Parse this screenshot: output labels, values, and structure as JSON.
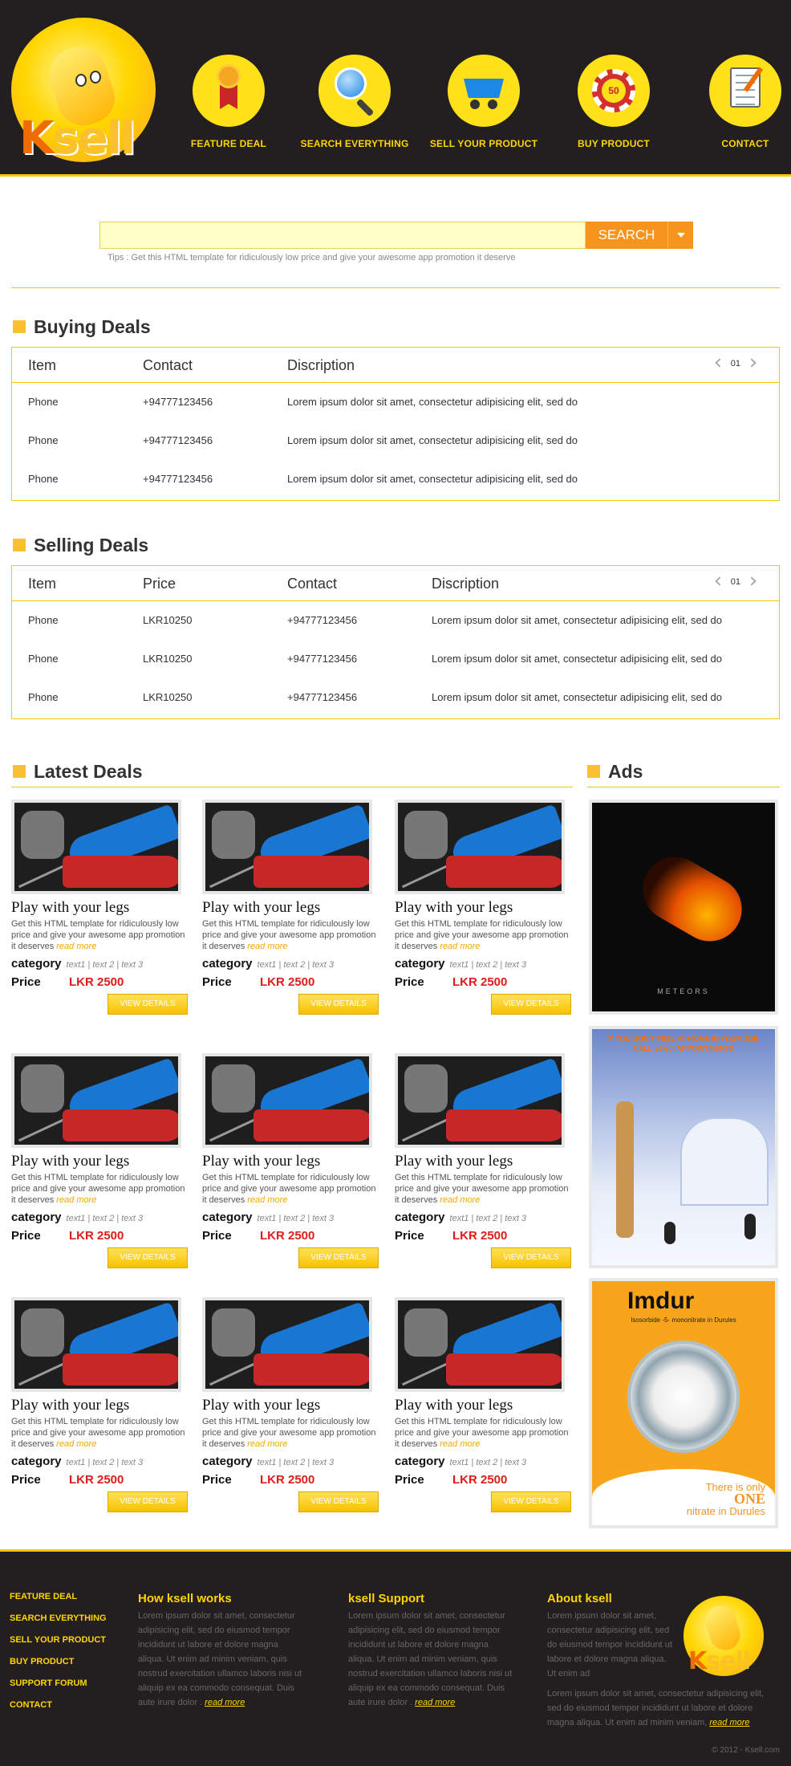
{
  "nav": [
    {
      "label": "FEATURE DEAL",
      "icon": "medal-icon"
    },
    {
      "label": "SEARCH EVERYTHING",
      "icon": "globe-search-icon"
    },
    {
      "label": "SELL YOUR PRODUCT",
      "icon": "cart-icon"
    },
    {
      "label": "BUY PRODUCT",
      "icon": "chip-icon"
    },
    {
      "label": "CONTACT",
      "icon": "notepad-icon"
    }
  ],
  "logo": {
    "k": "K",
    "sell": "sell"
  },
  "search": {
    "button": "SEARCH",
    "tips": "Tips : Get this HTML template for ridiculously low price and give your awesome app promotion it deserve"
  },
  "buying": {
    "title": "Buying Deals",
    "headers": [
      "Item",
      "Contact",
      "Discription"
    ],
    "page": "01",
    "rows": [
      [
        "Phone",
        "+94777123456",
        "Lorem ipsum dolor sit amet, consectetur adipisicing elit, sed do"
      ],
      [
        "Phone",
        "+94777123456",
        "Lorem ipsum dolor sit amet, consectetur adipisicing elit, sed do"
      ],
      [
        "Phone",
        "+94777123456",
        "Lorem ipsum dolor sit amet, consectetur adipisicing elit, sed do"
      ]
    ]
  },
  "selling": {
    "title": "Selling Deals",
    "headers": [
      "Item",
      "Price",
      "Contact",
      "Discription"
    ],
    "page": "01",
    "rows": [
      [
        "Phone",
        "LKR10250",
        "+94777123456",
        "Lorem ipsum dolor sit amet, consectetur adipisicing elit, sed do"
      ],
      [
        "Phone",
        "LKR10250",
        "+94777123456",
        "Lorem ipsum dolor sit amet, consectetur adipisicing elit, sed do"
      ],
      [
        "Phone",
        "LKR10250",
        "+94777123456",
        "Lorem ipsum dolor sit amet, consectetur adipisicing elit, sed do"
      ]
    ]
  },
  "latest": {
    "title": "Latest Deals",
    "card": {
      "title": "Play with your legs",
      "desc": "Get this HTML template for ridiculously low price and give your awesome app promotion it deserves",
      "read_more": "read more",
      "category_label": "category",
      "category_tags": "text1 | text 2 | text 3",
      "price_label": "Price",
      "price": "LKR 2500",
      "button": "VIEW DETAILS"
    }
  },
  "ads": {
    "title": "Ads",
    "ad1": {
      "text": "METEORS"
    },
    "ad2": {
      "text": "IF YOU DON'T FEEL AT HOME IN YOUR JOB, CALL sélect APPOINTMENTS"
    },
    "ad3": {
      "brand": "Imdur",
      "sub": "Isosorbide -5- mononitrate in Durules",
      "tag1": "There is only",
      "tag2": "ONE",
      "tag3": "nitrate in Durules"
    }
  },
  "footer": {
    "links": [
      "FEATURE DEAL",
      "SEARCH EVERYTHING",
      "SELL YOUR PRODUCT",
      "BUY PRODUCT",
      "SUPPORT FORUM",
      "CONTACT"
    ],
    "cols": [
      {
        "title": "How ksell works",
        "text": "Lorem ipsum dolor sit amet, consectetur adipisicing elit, sed do eiusmod tempor incididunt ut labore et dolore magna aliqua. Ut enim ad minim veniam, quis nostrud exercitation ullamco laboris nisi ut aliquip ex ea commodo consequat. Duis aute irure dolor .",
        "link": "read more"
      },
      {
        "title": "ksell Support",
        "text": "Lorem ipsum dolor sit amet, consectetur adipisicing elit, sed do eiusmod tempor incididunt ut labore et dolore magna aliqua. Ut enim ad minim veniam, quis nostrud exercitation ullamco laboris nisi ut aliquip ex ea commodo consequat. Duis aute irure dolor .",
        "link": "read more"
      },
      {
        "title": "About ksell",
        "text": "Lorem ipsum dolor sit amet, consectetur adipisicing elit, sed do eiusmod tempor incididunt ut labore et dolore magna aliqua. Ut enim ad",
        "text2": "Lorem ipsum dolor sit amet, consectetur adipisicing elit, sed do eiusmod tempor incididunt ut labore et dolore magna aliqua. Ut enim ad minim veniam,",
        "link": "read more"
      }
    ],
    "copyright": "© 2012 - Ksell.com"
  }
}
